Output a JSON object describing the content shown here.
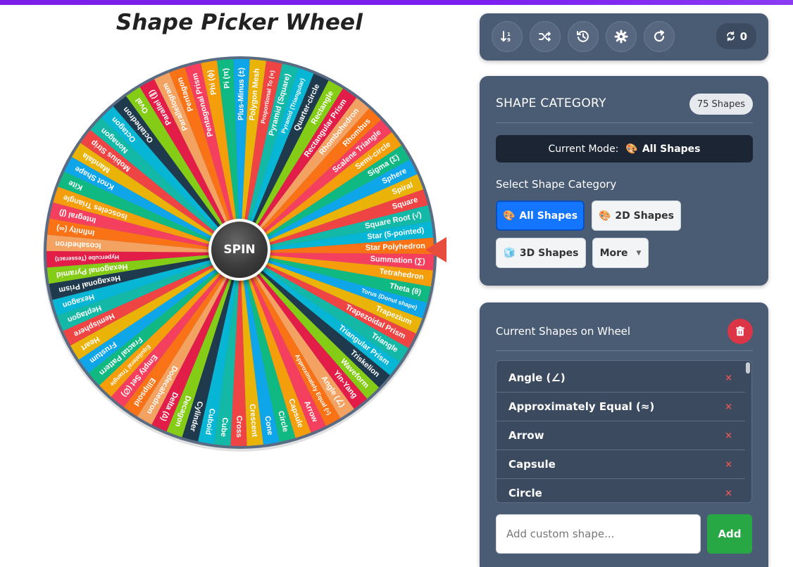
{
  "page": {
    "title": "Shape Picker Wheel"
  },
  "wheel": {
    "spin_label": "SPIN",
    "colors": [
      "#f97316",
      "#f43f5e",
      "#f59e0b",
      "#10b981",
      "#0ea5e9",
      "#eab308",
      "#ef4444",
      "#14b8a6",
      "#06b6d4",
      "#1e3a4c",
      "#84cc16",
      "#e11d48",
      "#f4a261"
    ],
    "segments": [
      "Star Polyhedron",
      "Summation (∑)",
      "Tetrahedron",
      "Theta (θ)",
      "Torus (Donut shape)",
      "Trapezium",
      "Trapezoidal Prism",
      "Triangle",
      "Triangular Prism",
      "Triskelion",
      "Waveform",
      "Yin-Yang",
      "Angle (∠)",
      "Approximately Equal (≈)",
      "Arrow",
      "Capsule",
      "Circle",
      "Cone",
      "Crescent",
      "Cross",
      "Cube",
      "Cuboid",
      "Cylinder",
      "Decagon",
      "Delta (∆)",
      "Dodecahedron",
      "Ellipsoid",
      "Empty Set (∅)",
      "Equilateral Triangle",
      "Fractal Pattern",
      "Frustum",
      "Heart",
      "Hemisphere",
      "Heptagon",
      "Hexagon",
      "Hexagonal Prism",
      "Hexagonal Pyramid",
      "Hypercube (Tesseract)",
      "Icosahedron",
      "Infinity (∞)",
      "Integral (∫)",
      "Isosceles Triangle",
      "Kite",
      "Knot Shape",
      "Mandala",
      "Mobius Strip",
      "Nonagon",
      "Octagon",
      "Octahedron",
      "Oval",
      "Parallel (∥)",
      "Parallelogram",
      "Pentagon",
      "Pentagonal Prism",
      "Phi (ϕ)",
      "Pi (π)",
      "Plus-Minus (±)",
      "Polygon Mesh",
      "Proportional To (∝)",
      "Pyramid (Square)",
      "Pyramid (Triangular)",
      "Quarter-circle",
      "Rectangle",
      "Rectangular Prism",
      "Rhombohedron",
      "Rhombus",
      "Scalene Triangle",
      "Semi-circle",
      "Sigma (Σ)",
      "Sphere",
      "Spiral",
      "Square",
      "Square Root (√)",
      "Star (5-pointed)"
    ]
  },
  "toolbar": {
    "buttons": [
      "sort-icon",
      "shuffle-icon",
      "history-icon",
      "gear-icon",
      "refresh-icon"
    ],
    "spin_count": "0"
  },
  "category": {
    "title": "SHAPE CATEGORY",
    "count_badge": "75 Shapes",
    "mode_label": "Current Mode:",
    "mode_icon": "🎨",
    "mode_value": "All Shapes",
    "select_label": "Select Shape Category",
    "buttons": [
      {
        "icon": "🎨",
        "label": "All Shapes"
      },
      {
        "icon": "🎨",
        "label": "2D Shapes"
      },
      {
        "icon": "🧊",
        "label": "3D Shapes"
      },
      {
        "icon": "",
        "label": "More"
      }
    ]
  },
  "shapes_panel": {
    "title": "Current Shapes on Wheel",
    "items": [
      "Angle (∠)",
      "Approximately Equal (≈)",
      "Arrow",
      "Capsule",
      "Circle"
    ],
    "remove_symbol": "×",
    "input_placeholder": "Add custom shape...",
    "add_label": "Add"
  }
}
